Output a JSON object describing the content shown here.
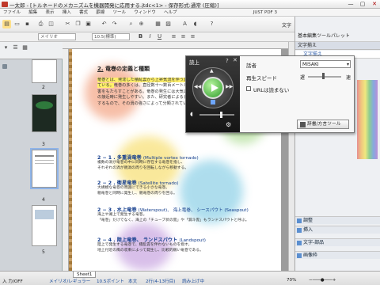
{
  "window": {
    "title": "一太郎 - [トルネードのメカニズムを機器開発に応用する.jtdc<1> - 保存形式:通常 (圧縮)]",
    "controls": [
      "—",
      "▢",
      "✕"
    ]
  },
  "menu": [
    "ファイル",
    "編集",
    "表示",
    "挿入",
    "書式",
    "罫線",
    "ツール",
    "ウィンドウ",
    "ヘルプ",
    "",
    "",
    "JUST PDF 3"
  ],
  "toolbar": {
    "font_select": "メイリオ",
    "size_select": "10.5(標準)",
    "right_label": "文字"
  },
  "left_panel": {
    "pages": [
      "2",
      "3",
      "4",
      "5"
    ]
  },
  "document": {
    "heading_num": "2.",
    "heading_text": "竜巻の定義と種類",
    "para1_highlight": "竜巻とは、発達した積乱雲から上昇気流を伴う激しい渦巻きで、地上に達しているものと定義されている。",
    "para1_rest": "竜巻の多くは、直径数十〜数百メートルで、数キロメートルにわたって移動し、大きな被害をもたらすことがある。竜巻の発生には大気の不安定な状態が必要で、寒冷前線の通過時や台風の接近時に発生しやすい。また、研究者によると、竜巻は渦を伴う強い上昇気流を中心にして発生するもので、その渦の強さによって分類されている。",
    "sections": [
      {
        "title": "2 − 1 . 多重渦竜巻",
        "en": "(Multiple vortex tornado)",
        "desc": "複数の渦が竜巻の中に同時に存在する竜巻を指し、\nそれぞれの渦が親渦の周りを回転しながら移動する。"
      },
      {
        "title": "2 − 2 . 衛星竜巻",
        "en": "(Satellite tornado)",
        "desc": "大規模な竜巻の周囲にできる小さな竜巻。\n親竜巻と同時に発生し、親竜巻の周りを回る。"
      },
      {
        "title": "2 − 3 . 水上竜巻",
        "en": "(Waterspout)、 海上竜巻、 シースパウト (Seaspout)",
        "desc": "海上や湖上で発生する竜巻。\n「竜巻」だけでなく、海上の「チューブ状の雲」や「漏斗雲」もランドスパウトと呼ぶ。"
      },
      {
        "title": "2 − 4 . 陸上竜巻、 ランドスパウト",
        "en": "(Landspout)",
        "desc": "陸上で発生する竜巻で、積乱雲を伴わないものを指す。\n地上付近の風の収束によって発生し、比較的弱い竜巻である。"
      }
    ]
  },
  "right_panel": {
    "header": "基本編集ツールパレット",
    "palette_title": "文字揃え",
    "tab_label": "文字揃え",
    "sections": [
      "調整",
      "挿入",
      "文字-部品",
      "画像枠"
    ]
  },
  "speech_dialog": {
    "title": "読上",
    "help": "?",
    "close": "✕",
    "speaker_label": "話者",
    "speaker_value": "MISAKI",
    "speed_label": "再生スピード",
    "slow": "遅",
    "fast": "速",
    "url_label": "URLは読まない",
    "dict_button": "辞書/方言ツール"
  },
  "status": {
    "sheet_tab": "Sheet1",
    "left": "入 力/OFF",
    "font": "メイリオ/レギュラー",
    "size": "10.5ポイント",
    "mode": "本文",
    "pos": "2行(4-13行目)",
    "extra": "読み上げ中",
    "zoom": "70%"
  }
}
